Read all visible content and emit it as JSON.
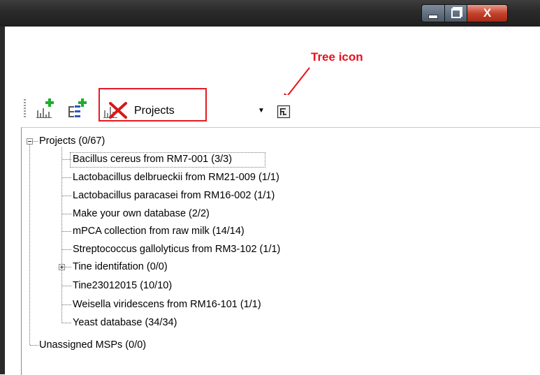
{
  "window": {
    "controls": {
      "minimize": "minimize",
      "maximize": "restore",
      "close": "X"
    }
  },
  "annotation": {
    "label": "Tree icon",
    "color": "#e8101b"
  },
  "toolbar": {
    "icons": [
      "add-spectrum-icon",
      "add-tree-icon",
      "delete-project-icon",
      "tree-icon"
    ],
    "combo": {
      "value": "Projects"
    }
  },
  "tree": {
    "root": {
      "label": "Projects (0/67)",
      "expanded": true
    },
    "children": [
      {
        "label": "Bacillus cereus from RM7-001 (3/3)",
        "selected": true
      },
      {
        "label": "Lactobacillus delbrueckii from RM21-009 (1/1)"
      },
      {
        "label": "Lactobacillus paracasei from RM16-002 (1/1)"
      },
      {
        "label": "Make your own database (2/2)"
      },
      {
        "label": "mPCA collection from raw milk (14/14)"
      },
      {
        "label": "Streptococcus gallolyticus from RM3-102 (1/1)"
      },
      {
        "label": "Tine identifation (0/0)",
        "expandable": true
      },
      {
        "label": "Tine23012015 (10/10)"
      },
      {
        "label": "Weisella viridescens from RM16-101 (1/1)"
      },
      {
        "label": "Yeast database (34/34)"
      }
    ],
    "unassigned": {
      "label": "Unassigned MSPs (0/0)"
    }
  }
}
